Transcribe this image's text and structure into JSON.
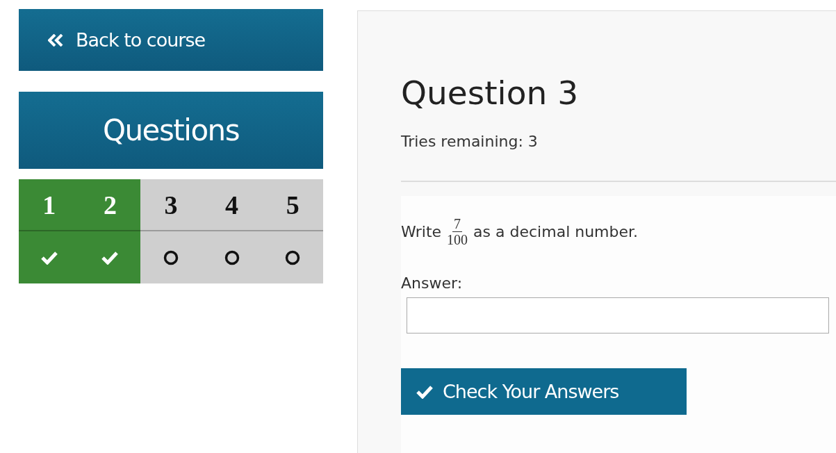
{
  "sidebar": {
    "back_link": "Back to course",
    "questions_heading": "Questions",
    "questions": [
      {
        "number": "1",
        "completed": true
      },
      {
        "number": "2",
        "completed": true
      },
      {
        "number": "3",
        "completed": false
      },
      {
        "number": "4",
        "completed": false
      },
      {
        "number": "5",
        "completed": false
      }
    ]
  },
  "question": {
    "title": "Question 3",
    "tries": "Tries remaining: 3",
    "prompt": {
      "before": "Write",
      "numerator": "7",
      "denominator": "100",
      "after": "as a decimal number."
    },
    "answer_label": "Answer:",
    "submit": "Check Your Answers"
  }
}
